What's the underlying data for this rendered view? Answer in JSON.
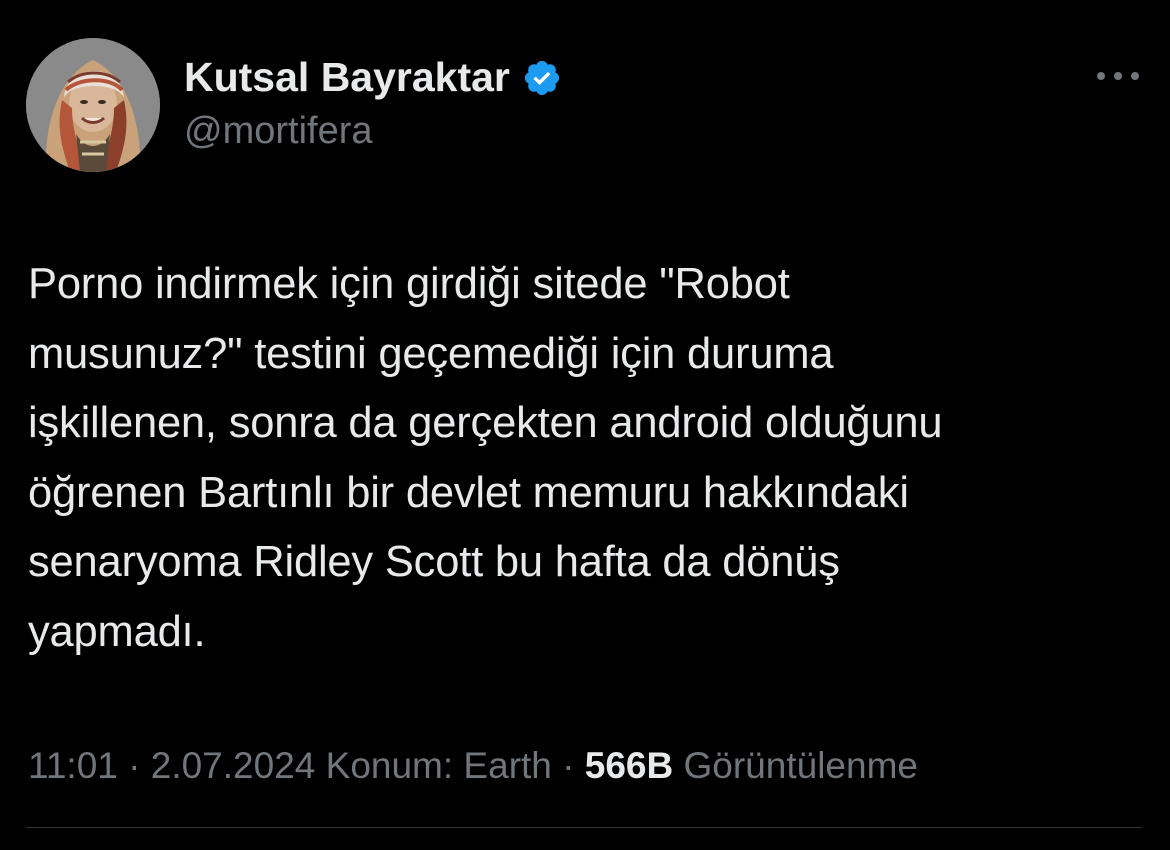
{
  "author": {
    "display_name": "Kutsal Bayraktar",
    "handle": "@mortifera",
    "verified": true,
    "avatar_icon": "profile-photo-headscarf"
  },
  "tweet": {
    "text": "Porno indirmek için girdiği sitede \"Robot\nmusunuz?\" testini geçemediği için duruma\nişkillenen, sonra da gerçekten android olduğunu\nöğrenen Bartınlı bir devlet memuru hakkındaki\nsenaryoma Ridley Scott bu hafta da dönüş\nyapmadı."
  },
  "meta": {
    "time": "11:01",
    "separator": "·",
    "date": "2.07.2024",
    "location_label": "Konum: Earth",
    "views_count": "566B",
    "views_label": "Görüntülenme"
  },
  "icons": {
    "more": "more-horizontal-icon",
    "verified": "verified-badge-icon"
  },
  "colors": {
    "background": "#000000",
    "primary_text": "#e7e9ea",
    "secondary_text": "#71767b",
    "verified_blue": "#1d9bf0",
    "divider": "#2f3336"
  }
}
